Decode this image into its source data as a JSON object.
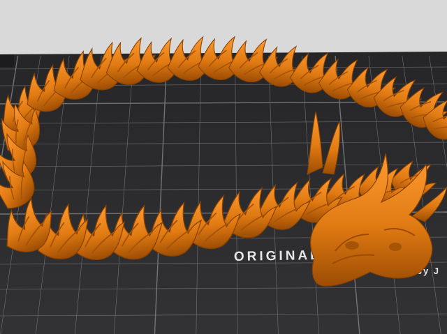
{
  "viewport": {
    "name": "3D print bed preview",
    "background_color": "#d9d9d9",
    "bed_color": "#2b2b2d",
    "grid_color": "#8c8c8e",
    "model_color": "#e07a12",
    "model_shadow_color": "#8a4300",
    "model_highlight_color": "#ffa648"
  },
  "bed": {
    "logo_line": "ORIGINAL PRUSA",
    "sub_line": "by J"
  }
}
